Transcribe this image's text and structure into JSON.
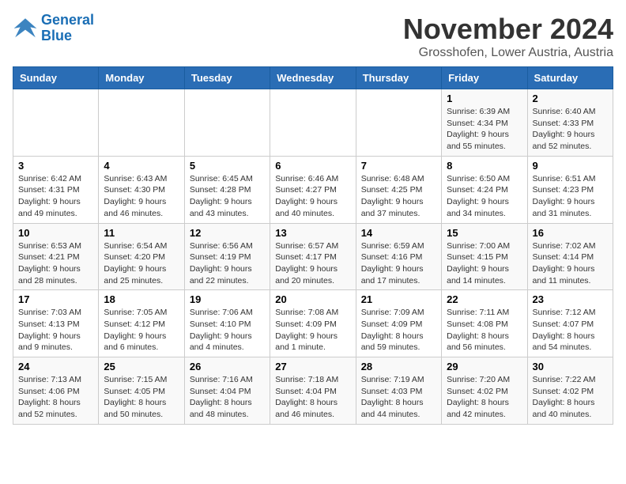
{
  "logo": {
    "line1": "General",
    "line2": "Blue"
  },
  "title": "November 2024",
  "location": "Grosshofen, Lower Austria, Austria",
  "days_of_week": [
    "Sunday",
    "Monday",
    "Tuesday",
    "Wednesday",
    "Thursday",
    "Friday",
    "Saturday"
  ],
  "weeks": [
    [
      {
        "day": "",
        "info": ""
      },
      {
        "day": "",
        "info": ""
      },
      {
        "day": "",
        "info": ""
      },
      {
        "day": "",
        "info": ""
      },
      {
        "day": "",
        "info": ""
      },
      {
        "day": "1",
        "info": "Sunrise: 6:39 AM\nSunset: 4:34 PM\nDaylight: 9 hours and 55 minutes."
      },
      {
        "day": "2",
        "info": "Sunrise: 6:40 AM\nSunset: 4:33 PM\nDaylight: 9 hours and 52 minutes."
      }
    ],
    [
      {
        "day": "3",
        "info": "Sunrise: 6:42 AM\nSunset: 4:31 PM\nDaylight: 9 hours and 49 minutes."
      },
      {
        "day": "4",
        "info": "Sunrise: 6:43 AM\nSunset: 4:30 PM\nDaylight: 9 hours and 46 minutes."
      },
      {
        "day": "5",
        "info": "Sunrise: 6:45 AM\nSunset: 4:28 PM\nDaylight: 9 hours and 43 minutes."
      },
      {
        "day": "6",
        "info": "Sunrise: 6:46 AM\nSunset: 4:27 PM\nDaylight: 9 hours and 40 minutes."
      },
      {
        "day": "7",
        "info": "Sunrise: 6:48 AM\nSunset: 4:25 PM\nDaylight: 9 hours and 37 minutes."
      },
      {
        "day": "8",
        "info": "Sunrise: 6:50 AM\nSunset: 4:24 PM\nDaylight: 9 hours and 34 minutes."
      },
      {
        "day": "9",
        "info": "Sunrise: 6:51 AM\nSunset: 4:23 PM\nDaylight: 9 hours and 31 minutes."
      }
    ],
    [
      {
        "day": "10",
        "info": "Sunrise: 6:53 AM\nSunset: 4:21 PM\nDaylight: 9 hours and 28 minutes."
      },
      {
        "day": "11",
        "info": "Sunrise: 6:54 AM\nSunset: 4:20 PM\nDaylight: 9 hours and 25 minutes."
      },
      {
        "day": "12",
        "info": "Sunrise: 6:56 AM\nSunset: 4:19 PM\nDaylight: 9 hours and 22 minutes."
      },
      {
        "day": "13",
        "info": "Sunrise: 6:57 AM\nSunset: 4:17 PM\nDaylight: 9 hours and 20 minutes."
      },
      {
        "day": "14",
        "info": "Sunrise: 6:59 AM\nSunset: 4:16 PM\nDaylight: 9 hours and 17 minutes."
      },
      {
        "day": "15",
        "info": "Sunrise: 7:00 AM\nSunset: 4:15 PM\nDaylight: 9 hours and 14 minutes."
      },
      {
        "day": "16",
        "info": "Sunrise: 7:02 AM\nSunset: 4:14 PM\nDaylight: 9 hours and 11 minutes."
      }
    ],
    [
      {
        "day": "17",
        "info": "Sunrise: 7:03 AM\nSunset: 4:13 PM\nDaylight: 9 hours and 9 minutes."
      },
      {
        "day": "18",
        "info": "Sunrise: 7:05 AM\nSunset: 4:12 PM\nDaylight: 9 hours and 6 minutes."
      },
      {
        "day": "19",
        "info": "Sunrise: 7:06 AM\nSunset: 4:10 PM\nDaylight: 9 hours and 4 minutes."
      },
      {
        "day": "20",
        "info": "Sunrise: 7:08 AM\nSunset: 4:09 PM\nDaylight: 9 hours and 1 minute."
      },
      {
        "day": "21",
        "info": "Sunrise: 7:09 AM\nSunset: 4:09 PM\nDaylight: 8 hours and 59 minutes."
      },
      {
        "day": "22",
        "info": "Sunrise: 7:11 AM\nSunset: 4:08 PM\nDaylight: 8 hours and 56 minutes."
      },
      {
        "day": "23",
        "info": "Sunrise: 7:12 AM\nSunset: 4:07 PM\nDaylight: 8 hours and 54 minutes."
      }
    ],
    [
      {
        "day": "24",
        "info": "Sunrise: 7:13 AM\nSunset: 4:06 PM\nDaylight: 8 hours and 52 minutes."
      },
      {
        "day": "25",
        "info": "Sunrise: 7:15 AM\nSunset: 4:05 PM\nDaylight: 8 hours and 50 minutes."
      },
      {
        "day": "26",
        "info": "Sunrise: 7:16 AM\nSunset: 4:04 PM\nDaylight: 8 hours and 48 minutes."
      },
      {
        "day": "27",
        "info": "Sunrise: 7:18 AM\nSunset: 4:04 PM\nDaylight: 8 hours and 46 minutes."
      },
      {
        "day": "28",
        "info": "Sunrise: 7:19 AM\nSunset: 4:03 PM\nDaylight: 8 hours and 44 minutes."
      },
      {
        "day": "29",
        "info": "Sunrise: 7:20 AM\nSunset: 4:02 PM\nDaylight: 8 hours and 42 minutes."
      },
      {
        "day": "30",
        "info": "Sunrise: 7:22 AM\nSunset: 4:02 PM\nDaylight: 8 hours and 40 minutes."
      }
    ]
  ]
}
